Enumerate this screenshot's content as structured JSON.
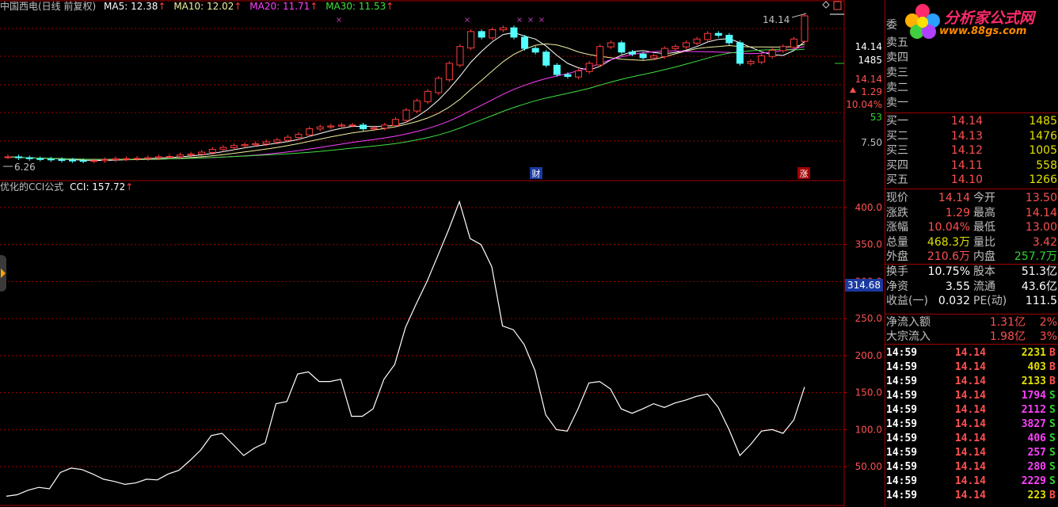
{
  "header": {
    "stock_title": "中国西电(日线 前复权)",
    "ma5": "MA5: 12.38",
    "ma10": "MA10: 12.02",
    "ma20": "MA20: 11.71",
    "ma30": "MA30: 11.53",
    "arrow": "↑"
  },
  "colors": {
    "ma5": "#ffffff",
    "ma10": "#f0f0a0",
    "ma20": "#ff40ff",
    "ma30": "#40e040",
    "up": "#ff3c3c",
    "down": "#54ffff",
    "grid": "#a00000"
  },
  "main_chart": {
    "price_labels": [
      "14.14",
      "1485",
      "14.14",
      "1.29",
      "10.04%",
      "53",
      "7.50"
    ],
    "last_price_marker": "14.14",
    "low_marker": "6.26",
    "event_tags": [
      "财",
      "涨"
    ]
  },
  "cci": {
    "title": "优化的CCI公式",
    "value_label": "CCI: 157.72",
    "arrow": "↑",
    "axis_ticks": [
      "400.0",
      "350.0",
      "300.0",
      "250.0",
      "200.0",
      "150.0",
      "100.0",
      "50.00"
    ],
    "tick_values": [
      400,
      350,
      300,
      250,
      200,
      150,
      100,
      50
    ],
    "current_marker": "314.68",
    "series": [
      10,
      12,
      18,
      22,
      20,
      42,
      48,
      46,
      40,
      33,
      30,
      26,
      28,
      33,
      32,
      40,
      45,
      58,
      72,
      92,
      95,
      80,
      65,
      75,
      82,
      135,
      138,
      175,
      178,
      165,
      165,
      168,
      118,
      118,
      128,
      168,
      188,
      238,
      270,
      300,
      335,
      370,
      408,
      358,
      350,
      320,
      240,
      235,
      215,
      180,
      120,
      100,
      98,
      128,
      163,
      165,
      155,
      128,
      122,
      128,
      135,
      130,
      136,
      140,
      145,
      148,
      130,
      100,
      65,
      80,
      98,
      100,
      95,
      113,
      157.72
    ]
  },
  "quotes": {
    "committee_label": "委",
    "sell": [
      {
        "label": "卖五"
      },
      {
        "label": "卖四"
      },
      {
        "label": "卖三"
      },
      {
        "label": "卖二"
      },
      {
        "label": "卖一"
      }
    ],
    "buy": [
      {
        "label": "买一",
        "price": "14.14",
        "vol": "1485"
      },
      {
        "label": "买二",
        "price": "14.13",
        "vol": "1476"
      },
      {
        "label": "买三",
        "price": "14.12",
        "vol": "1005"
      },
      {
        "label": "买四",
        "price": "14.11",
        "vol": "558"
      },
      {
        "label": "买五",
        "price": "14.10",
        "vol": "1266"
      }
    ]
  },
  "stats": [
    {
      "l1": "现价",
      "v1": "14.14",
      "l2": "今开",
      "v2": "13.50"
    },
    {
      "l1": "涨跌",
      "v1": "1.29",
      "l2": "最高",
      "v2": "14.14"
    },
    {
      "l1": "涨幅",
      "v1": "10.04%",
      "l2": "最低",
      "v2": "13.00"
    },
    {
      "l1": "总量",
      "v1": "468.3万",
      "l2": "量比",
      "v2": "3.42"
    },
    {
      "l1": "外盘",
      "v1": "210.6万",
      "l2": "内盘",
      "v2": "257.7万"
    },
    {
      "l1": "换手",
      "v1": "10.75%",
      "l2": "股本",
      "v2": "51.3亿"
    },
    {
      "l1": "净资",
      "v1": "3.55",
      "l2": "流通",
      "v2": "43.6亿"
    },
    {
      "l1": "收益(一)",
      "v1": "0.032",
      "l2": "PE(动)",
      "v2": "111.5"
    }
  ],
  "flows": [
    {
      "label": "净流入额",
      "value": "1.31亿",
      "pct": "2%"
    },
    {
      "label": "大宗流入",
      "value": "1.98亿",
      "pct": "3%"
    }
  ],
  "ticks": [
    {
      "time": "14:59",
      "price": "14.14",
      "vol": "2231",
      "side": "B"
    },
    {
      "time": "14:59",
      "price": "14.14",
      "vol": "403",
      "side": "B"
    },
    {
      "time": "14:59",
      "price": "14.14",
      "vol": "2133",
      "side": "B"
    },
    {
      "time": "14:59",
      "price": "14.14",
      "vol": "1794",
      "side": "S"
    },
    {
      "time": "14:59",
      "price": "14.14",
      "vol": "2112",
      "side": "S"
    },
    {
      "time": "14:59",
      "price": "14.14",
      "vol": "3827",
      "side": "S"
    },
    {
      "time": "14:59",
      "price": "14.14",
      "vol": "406",
      "side": "S"
    },
    {
      "time": "14:59",
      "price": "14.14",
      "vol": "257",
      "side": "S"
    },
    {
      "time": "14:59",
      "price": "14.14",
      "vol": "280",
      "side": "S"
    },
    {
      "time": "14:59",
      "price": "14.14",
      "vol": "2229",
      "side": "S"
    },
    {
      "time": "14:59",
      "price": "14.14",
      "vol": "223",
      "side": "B"
    }
  ],
  "ad": {
    "title": "分析家公式网",
    "url": "www.88gs.com"
  }
}
